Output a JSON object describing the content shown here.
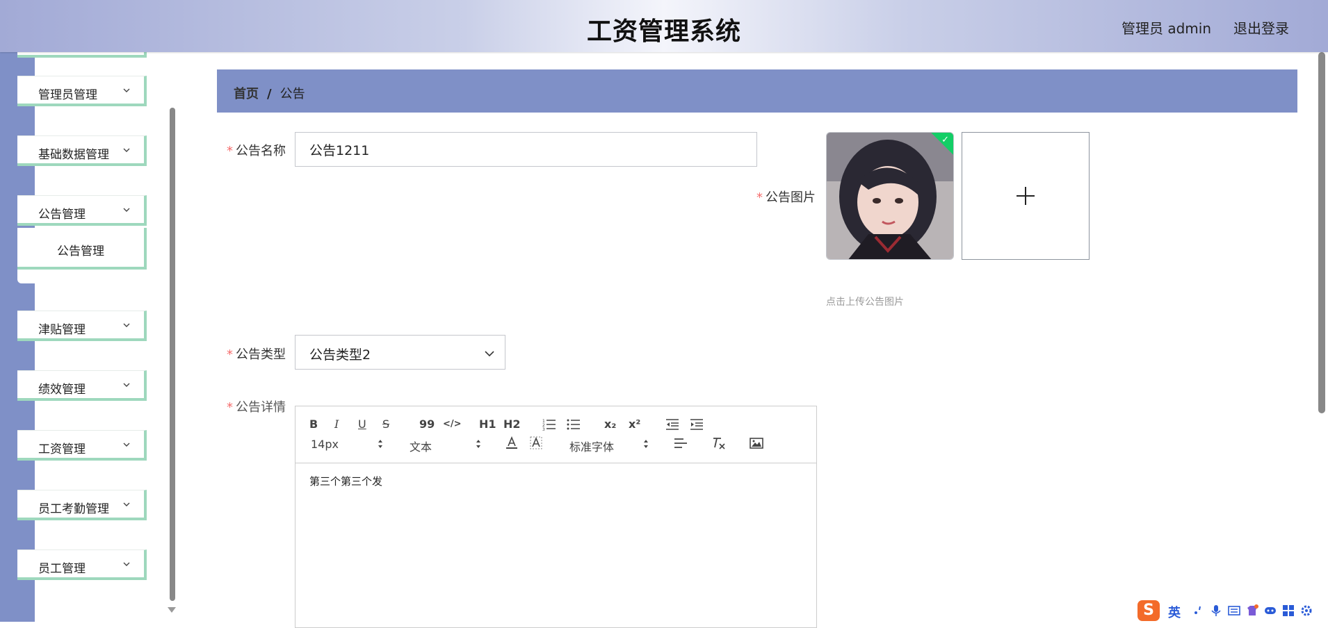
{
  "header": {
    "title": "工资管理系统",
    "user": "管理员 admin",
    "logout": "退出登录"
  },
  "sidebar": {
    "items": [
      {
        "label": "管理员管理"
      },
      {
        "label": "基础数据管理"
      },
      {
        "label": "公告管理"
      },
      {
        "label": "津贴管理"
      },
      {
        "label": "绩效管理"
      },
      {
        "label": "工资管理"
      },
      {
        "label": "员工考勤管理"
      },
      {
        "label": "员工管理"
      }
    ],
    "submenu": {
      "label": "公告管理"
    }
  },
  "breadcrumb": {
    "home": "首页",
    "separator": "/",
    "current": "公告"
  },
  "form": {
    "name_label": "公告名称",
    "name_value": "公告1211",
    "image_label": "公告图片",
    "image_hint": "点击上传公告图片",
    "type_label": "公告类型",
    "type_value": "公告类型2",
    "detail_label": "公告详情",
    "required_mark": "*"
  },
  "editor": {
    "toolbar": {
      "bold": "B",
      "italic": "I",
      "underline": "U",
      "strike": "S",
      "blockquote": "99",
      "code": "</>",
      "h1": "H1",
      "h2": "H2",
      "subscript": "x₂",
      "superscript": "x²",
      "font_size": "14px",
      "text_format": "文本",
      "font_family": "标准字体"
    },
    "content": "第三个第三个发"
  },
  "ime": {
    "logo": "S",
    "mode": "英"
  },
  "colors": {
    "header_gradient_edge": "#a2aad6",
    "sidebar_strip": "#7f90c7",
    "menu_accent": "#9ed8bd",
    "breadcrumb_bg": "#7f90c7",
    "required": "#f56c6c",
    "success": "#13ce66"
  }
}
